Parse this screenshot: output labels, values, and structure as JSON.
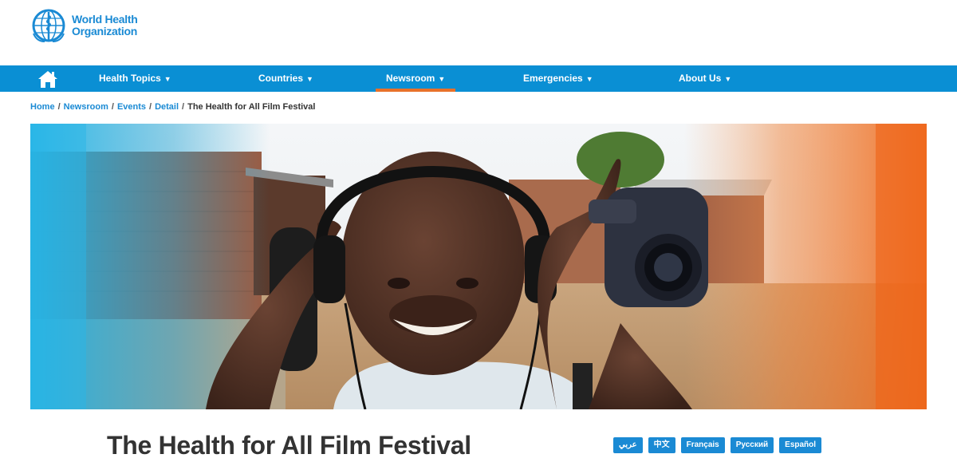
{
  "header": {
    "logo_line1": "World Health",
    "logo_line2": "Organization"
  },
  "nav": {
    "items": [
      {
        "label": "Health Topics"
      },
      {
        "label": "Countries"
      },
      {
        "label": "Newsroom"
      },
      {
        "label": "Emergencies"
      },
      {
        "label": "About Us"
      }
    ],
    "active": "Newsroom"
  },
  "breadcrumb": {
    "items": [
      "Home",
      "Newsroom",
      "Events",
      "Detail"
    ],
    "current": "The Health for All Film Festival"
  },
  "page": {
    "title": "The Health for All Film Festival"
  },
  "languages": [
    "عربي",
    "中文",
    "Français",
    "Русский",
    "Español"
  ],
  "colors": {
    "brand_blue": "#0a8fd4",
    "link_blue": "#1a8ad4",
    "accent_orange": "#e8712a"
  }
}
